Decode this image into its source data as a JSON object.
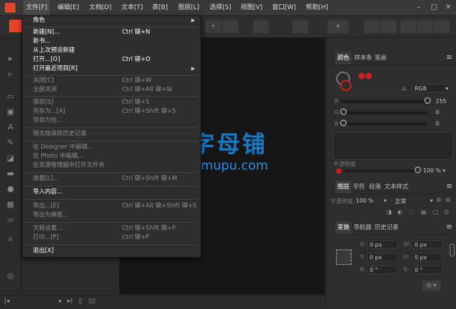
{
  "menubar": {
    "items": [
      "文件[F]",
      "编辑[E]",
      "文档[D]",
      "文本[T]",
      "表[B]",
      "图层[L]",
      "选择[S]",
      "视图[V]",
      "窗口[W]",
      "帮助[H]"
    ],
    "window_buttons": [
      "–",
      "□",
      "✕"
    ]
  },
  "file_menu": {
    "items": [
      {
        "label": "角色",
        "shortcut": "",
        "state": "enabled",
        "submenu": true
      },
      {
        "label": "新建[N]...",
        "shortcut": "Ctrl 键+N",
        "state": "enabled",
        "submenu": false
      },
      {
        "label": "新书...",
        "shortcut": "",
        "state": "enabled",
        "submenu": false
      },
      {
        "label": "从上次预设新建",
        "shortcut": "",
        "state": "enabled",
        "submenu": false
      },
      {
        "label": "打开...[O]",
        "shortcut": "Ctrl 键+O",
        "state": "enabled",
        "submenu": false
      },
      {
        "label": "打开最近项目[R]",
        "shortcut": "",
        "state": "enabled",
        "submenu": true
      },
      {
        "label": "关闭[C]",
        "shortcut": "Ctrl 键+W",
        "state": "disabled",
        "submenu": false
      },
      {
        "label": "全部关闭",
        "shortcut": "Ctrl 键+Alt 键+W",
        "state": "disabled",
        "submenu": false
      },
      {
        "label": "保存[S]",
        "shortcut": "Ctrl 键+S",
        "state": "disabled",
        "submenu": false
      },
      {
        "label": "另存为...[A]",
        "shortcut": "Ctrl 键+Shift 键+S",
        "state": "disabled",
        "submenu": false
      },
      {
        "label": "另存为包...",
        "shortcut": "",
        "state": "disabled",
        "submenu": false
      },
      {
        "label": "随文档保存历史记录",
        "shortcut": "",
        "state": "disabled",
        "submenu": false
      },
      {
        "label": "在 Designer 中编辑...",
        "shortcut": "",
        "state": "disabled",
        "submenu": false
      },
      {
        "label": "在 Photo 中编辑...",
        "shortcut": "",
        "state": "disabled",
        "submenu": false
      },
      {
        "label": "在资源管理器中打开文件夹",
        "shortcut": "",
        "state": "disabled",
        "submenu": false
      },
      {
        "label": "放置[L]...",
        "shortcut": "Ctrl 键+Shift 键+M",
        "state": "disabled",
        "submenu": false
      },
      {
        "label": "导入内容...",
        "shortcut": "",
        "state": "enabled",
        "submenu": false
      },
      {
        "label": "导出...[E]",
        "shortcut": "Ctrl 键+Alt 键+Shift 键+S",
        "state": "disabled",
        "submenu": false
      },
      {
        "label": "导出为模板...",
        "shortcut": "",
        "state": "disabled",
        "submenu": false
      },
      {
        "label": "文档设置...",
        "shortcut": "Ctrl 键+Shift 键+P",
        "state": "disabled",
        "submenu": false
      },
      {
        "label": "打印...[P]",
        "shortcut": "Ctrl 键+P",
        "state": "disabled",
        "submenu": false
      },
      {
        "label": "退出[X]",
        "shortcut": "",
        "state": "enabled",
        "submenu": false
      }
    ]
  },
  "color_panel": {
    "tabs": [
      "颜色",
      "样本条",
      "笔画"
    ],
    "mode": "RGB",
    "channels": [
      {
        "label": "R",
        "value": "255",
        "fraction": 1.0
      },
      {
        "label": "G",
        "value": "0",
        "fraction": 0.0
      },
      {
        "label": "B",
        "value": "0",
        "fraction": 0.0
      }
    ],
    "opacity_label": "不透明度",
    "opacity_value": "100 %",
    "accent_color": "#e02020"
  },
  "layers_panel": {
    "tabs": [
      "图层",
      "字符",
      "段落",
      "文本样式"
    ],
    "opacity_label": "不透明度:",
    "opacity_value": "100 %",
    "blend_mode": "正常"
  },
  "transform_panel": {
    "tabs": [
      "变换",
      "导航器",
      "历史记录"
    ],
    "fields": [
      {
        "label": "X:",
        "value": "0 px"
      },
      {
        "label": "W:",
        "value": "0 px"
      },
      {
        "label": "Y:",
        "value": "0 px"
      },
      {
        "label": "H:",
        "value": "0 px"
      },
      {
        "label": "R:",
        "value": "0 °"
      },
      {
        "label": "S:",
        "value": "0 °"
      }
    ]
  },
  "watermark": {
    "cn": "字母铺",
    "en": "zimupu.com"
  },
  "icons": [
    "app-logo-icon",
    "pointer-tool-icon",
    "node-tool-icon",
    "text-frame-icon",
    "picture-frame-icon",
    "artistic-text-icon",
    "pen-tool-icon",
    "rectangle-tool-icon",
    "ellipse-tool-icon",
    "zoom-tool-icon"
  ]
}
